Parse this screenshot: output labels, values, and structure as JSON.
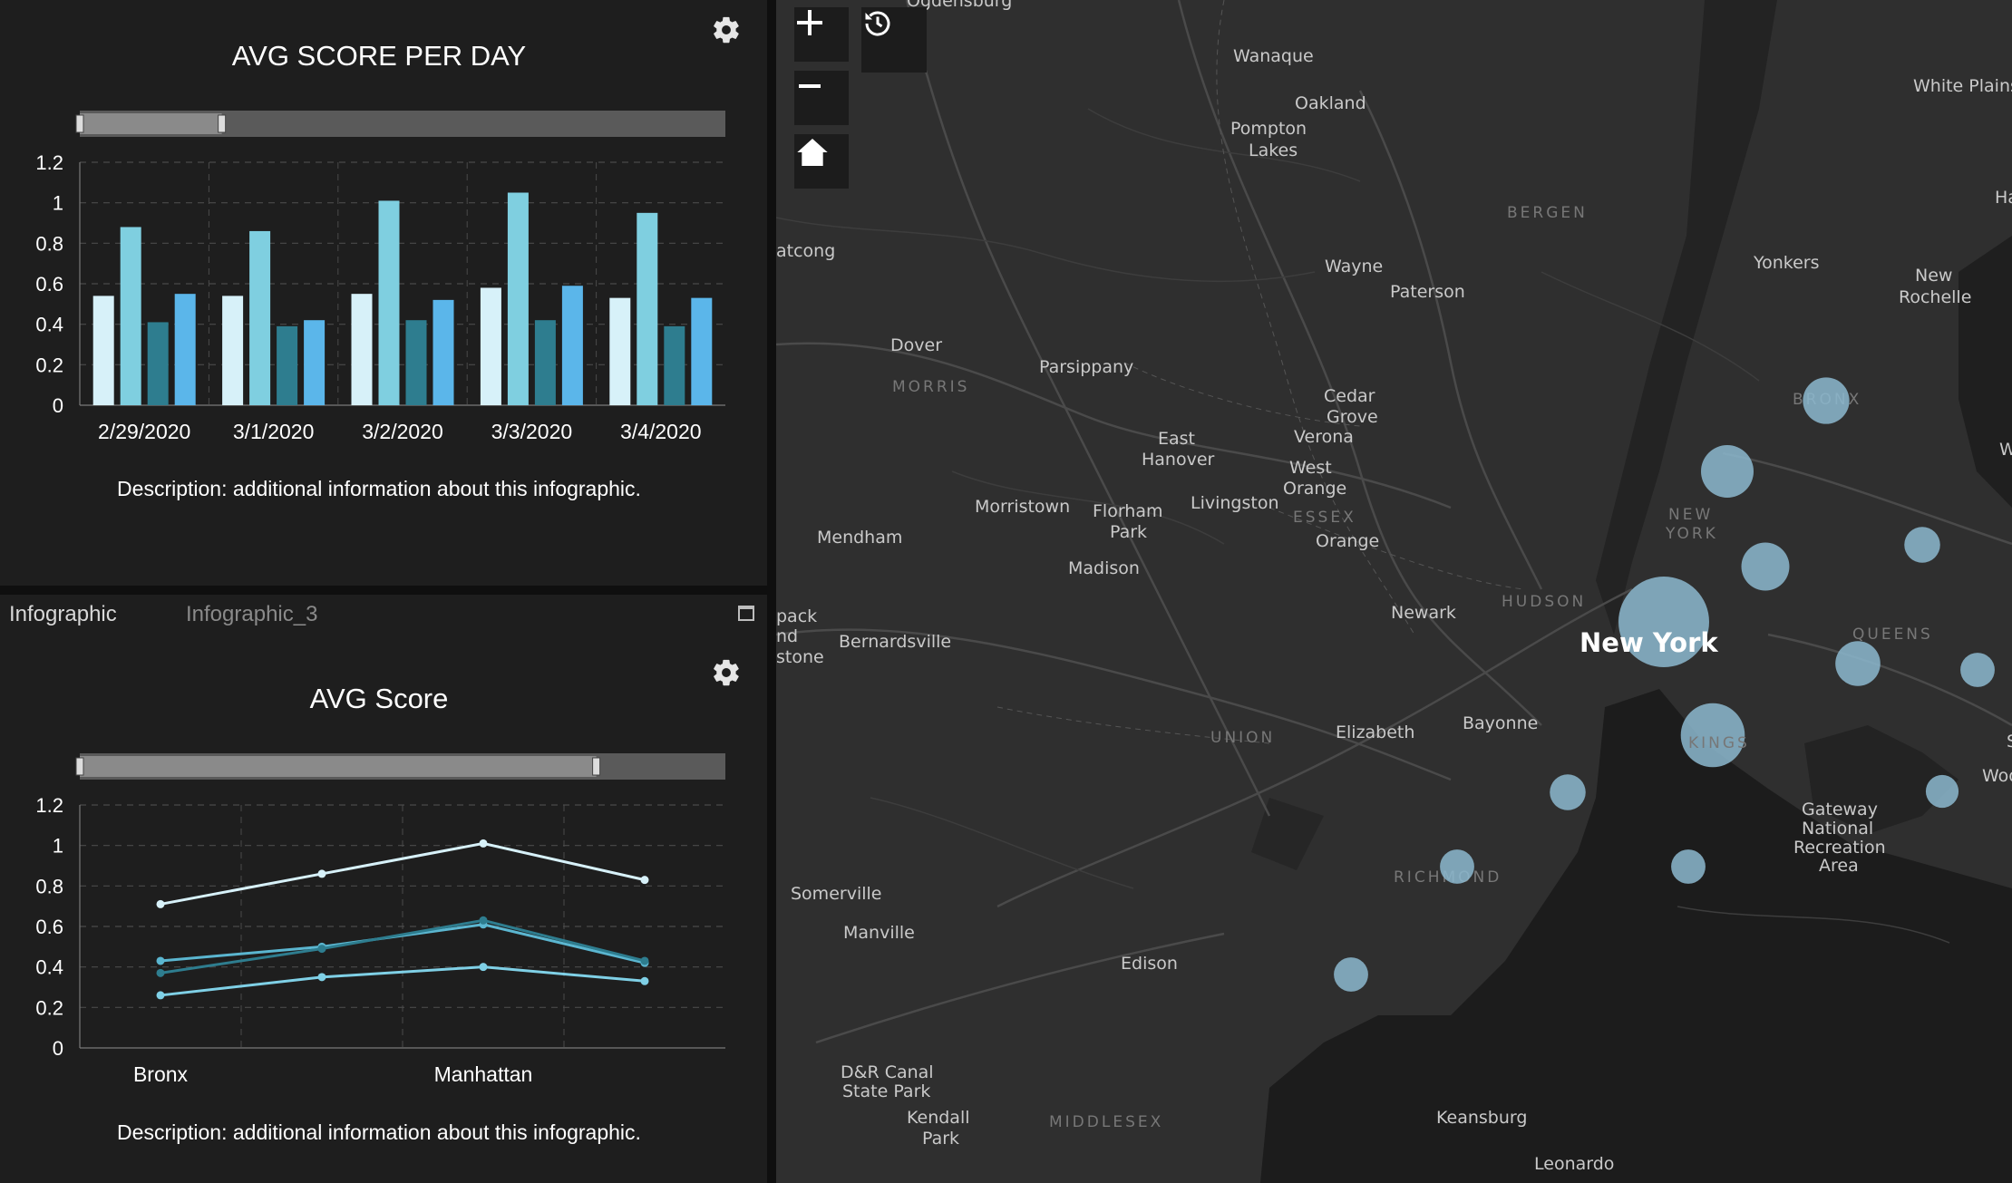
{
  "top_panel": {
    "gear_icon": "gear-icon",
    "description": "Description: additional information about this infographic."
  },
  "bottom_panel": {
    "tabs": [
      {
        "label": "Infographic",
        "active": true
      },
      {
        "label": "Infographic_3",
        "active": false
      }
    ],
    "gear_icon": "gear-icon",
    "maximize_icon": "maximize-icon",
    "description": "Description: additional information about this infographic."
  },
  "chart_data": [
    {
      "type": "bar",
      "title": "AVG SCORE PER DAY",
      "categories": [
        "2/29/2020",
        "3/1/2020",
        "3/2/2020",
        "3/3/2020",
        "3/4/2020"
      ],
      "series": [
        {
          "values": [
            0.54,
            0.54,
            0.55,
            0.58,
            0.53
          ],
          "color": "#d7f1f9"
        },
        {
          "values": [
            0.88,
            0.86,
            1.01,
            1.05,
            0.95
          ],
          "color": "#7fcfe0"
        },
        {
          "values": [
            0.41,
            0.39,
            0.42,
            0.42,
            0.39
          ],
          "color": "#2e7d8f"
        },
        {
          "values": [
            0.55,
            0.42,
            0.52,
            0.59,
            0.53
          ],
          "color": "#5bb6ea"
        }
      ],
      "ylim": [
        0,
        1.2
      ],
      "yticks": [
        "0",
        "0.2",
        "0.4",
        "0.6",
        "0.8",
        "1",
        "1.2"
      ],
      "grid": true,
      "range_slider": [
        0,
        0.22
      ]
    },
    {
      "type": "line",
      "title": "AVG Score",
      "categories": [
        "Bronx",
        "",
        "Manhattan",
        ""
      ],
      "series": [
        {
          "values": [
            0.71,
            0.86,
            1.01,
            0.83
          ],
          "color": "#d7f1f9"
        },
        {
          "values": [
            0.43,
            0.5,
            0.61,
            0.42
          ],
          "color": "#5bb6d0"
        },
        {
          "values": [
            0.37,
            0.49,
            0.63,
            0.43
          ],
          "color": "#2e7d8f"
        },
        {
          "values": [
            0.26,
            0.35,
            0.4,
            0.33
          ],
          "color": "#7fd0e6"
        }
      ],
      "ylim": [
        0,
        1.2
      ],
      "yticks": [
        "0",
        "0.2",
        "0.4",
        "0.6",
        "0.8",
        "1",
        "1.2"
      ],
      "grid": true,
      "range_slider": [
        0,
        0.8
      ]
    }
  ],
  "map": {
    "controls": [
      {
        "name": "zoom-in-button",
        "icon": "plus-icon"
      },
      {
        "name": "zoom-out-button",
        "icon": "minus-icon"
      },
      {
        "name": "home-button",
        "icon": "home-icon"
      },
      {
        "name": "history-button",
        "icon": "history-icon"
      }
    ],
    "labels": {
      "ogdensburg": "Ogdensburg",
      "wanaque": "Wanaque",
      "oakland": "Oakland",
      "pompton": "Pompton",
      "lakes": "Lakes",
      "white_plains": "White Plains",
      "ha": "Ha",
      "bergen": "BERGEN",
      "atcong": "atcong",
      "wayne": "Wayne",
      "paterson": "Paterson",
      "yonkers": "Yonkers",
      "new": "New",
      "rochelle": "Rochelle",
      "dover": "Dover",
      "morris": "MORRIS",
      "parsippany": "Parsippany",
      "cedar": "Cedar",
      "grove": "Grove",
      "verona": "Verona",
      "bronx": "BRONX",
      "w": "W",
      "east": "East",
      "hanover": "Hanover",
      "west": "West",
      "orange_w": "Orange",
      "morristown": "Morristown",
      "florham": "Florham",
      "park": "Park",
      "livingston": "Livingston",
      "essex": "ESSEX",
      "new_york_county_1": "NEW",
      "new_york_county_2": "YORK",
      "mendham": "Mendham",
      "orange": "Orange",
      "madison": "Madison",
      "newark": "Newark",
      "hudson": "HUDSON",
      "queens": "QUEENS",
      "pack": "pack",
      "nd": "nd",
      "stone": "stone",
      "bernardsville": "Bernardsville",
      "new_york": "New York",
      "union": "UNION",
      "elizabeth": "Elizabeth",
      "bayonne": "Bayonne",
      "kings": "KINGS",
      "s": "S",
      "woo": "Woo",
      "gateway": "Gateway",
      "national": "National",
      "recreation": "Recreation",
      "area": "Area",
      "richmond": "RICHMOND",
      "somerville": "Somerville",
      "manville": "Manville",
      "edison": "Edison",
      "dr_canal": "D&R Canal",
      "state_park": "State Park",
      "kendall": "Kendall",
      "kendall_park": "Park",
      "middlesex": "MIDDLESEX",
      "keansburg": "Keansburg",
      "leonardo": "Leonardo"
    },
    "bubble_color": "#8cb8cf",
    "bubbles": [
      {
        "label": "New York",
        "size": 1.0
      },
      {
        "label": "KINGS",
        "size": 0.65
      },
      {
        "label": "BRONX",
        "size": 0.42
      },
      {
        "label": "",
        "size": 0.5
      },
      {
        "label": "",
        "size": 0.44
      },
      {
        "label": "",
        "size": 0.4
      },
      {
        "label": "",
        "size": 0.28
      },
      {
        "label": "",
        "size": 0.28
      },
      {
        "label": "",
        "size": 0.26
      },
      {
        "label": "",
        "size": 0.26
      },
      {
        "label": "",
        "size": 0.26
      },
      {
        "label": "",
        "size": 0.26
      },
      {
        "label": "",
        "size": 0.24
      }
    ]
  }
}
